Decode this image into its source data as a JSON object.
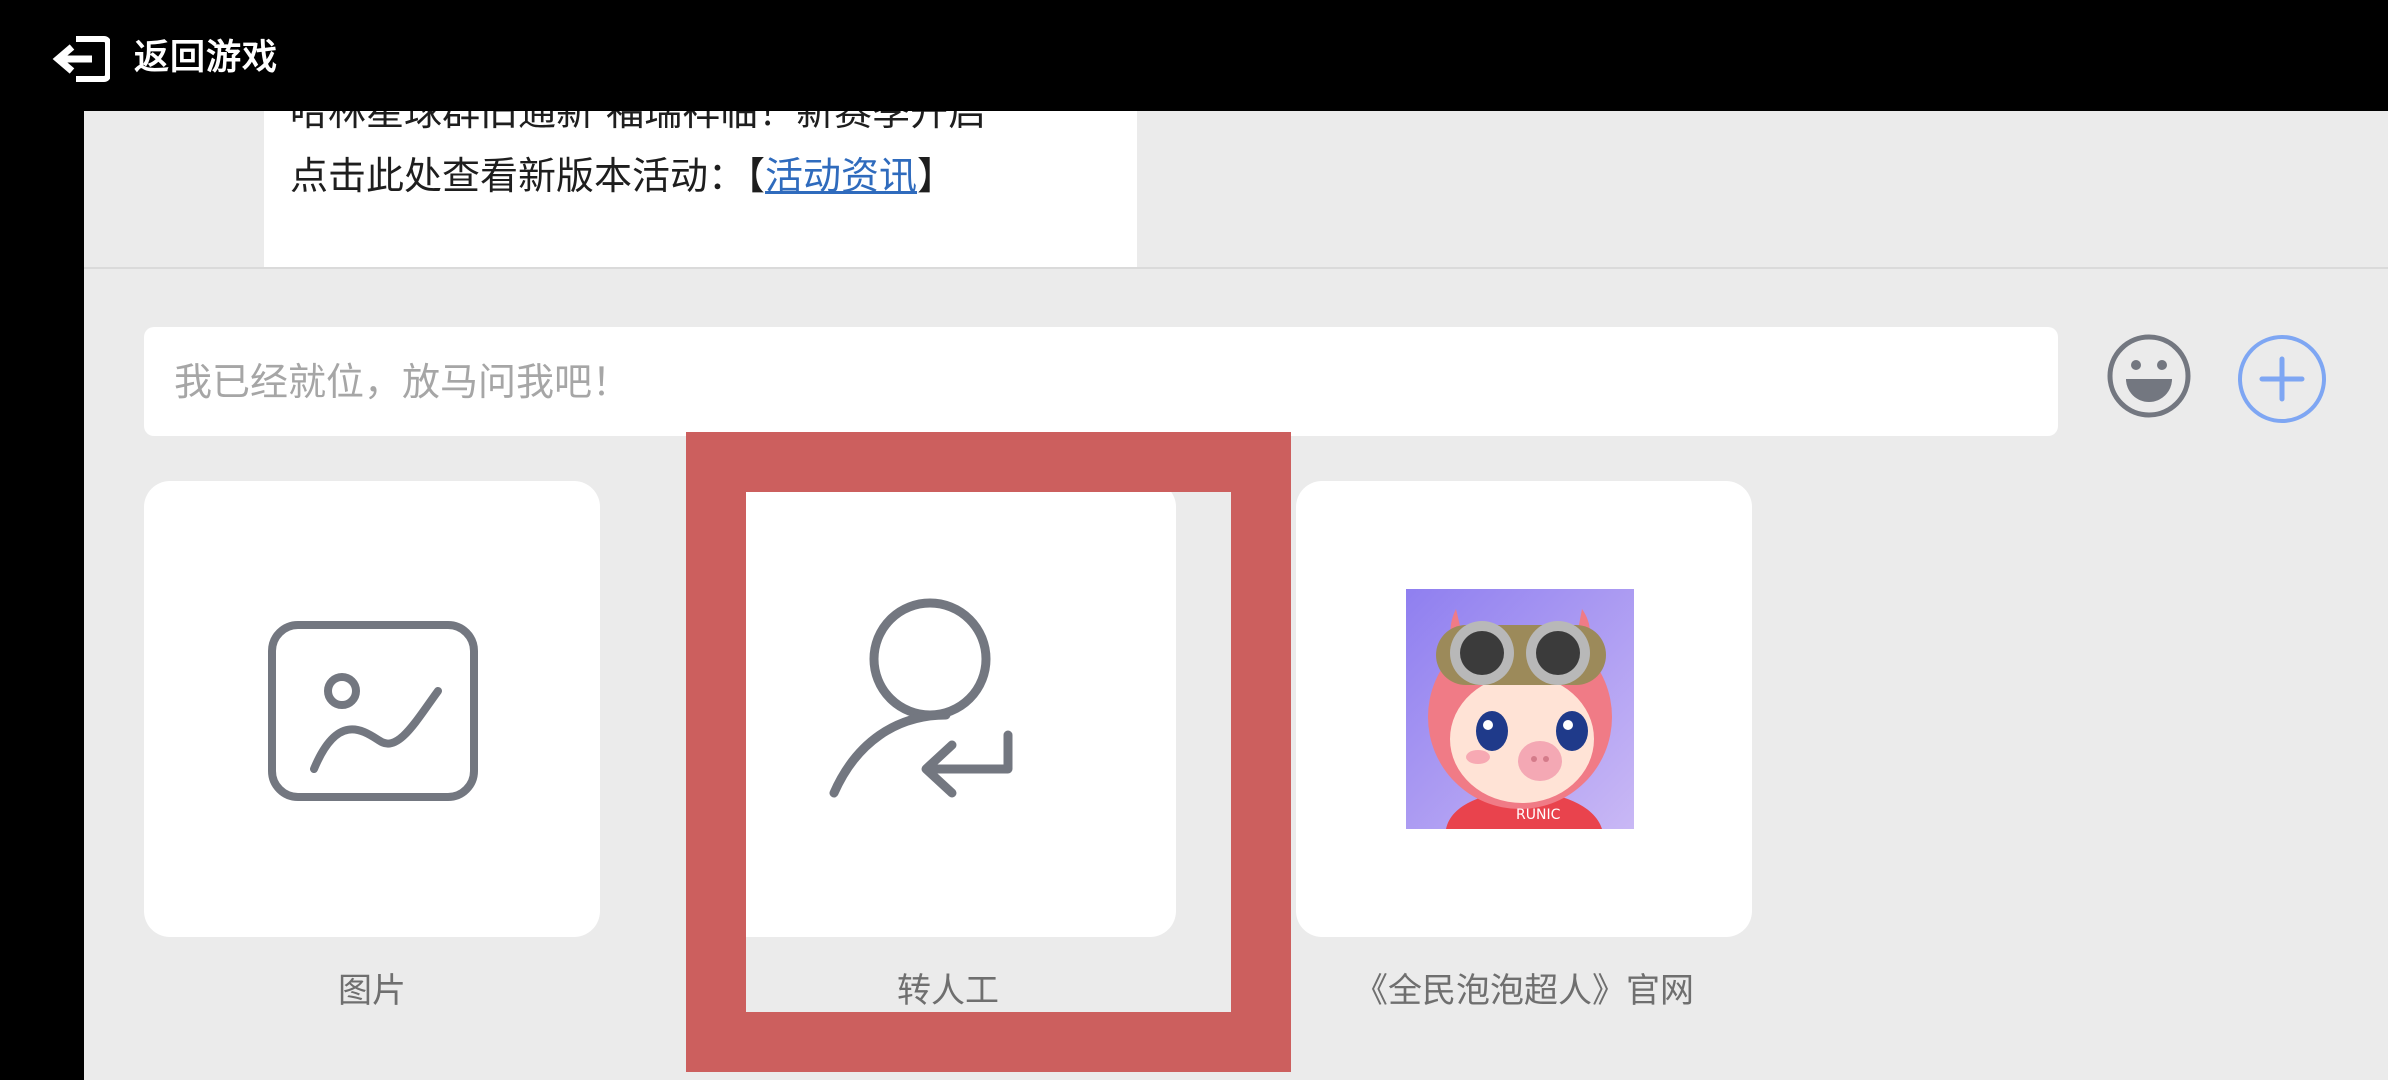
{
  "topbar": {
    "back_label": "返回游戏",
    "back_icon": "exit-arrow-icon"
  },
  "message": {
    "line1": "哈林星球群旧通新 福瑞祥临！新赛季开启",
    "line2_prefix": "点击此处查看新版本活动：【",
    "line2_link": "活动资讯",
    "line2_suffix": "】"
  },
  "input": {
    "placeholder": "我已经就位，放马问我吧！",
    "value": ""
  },
  "buttons": {
    "emoji_icon": "smiley-icon",
    "plus_icon": "plus-icon"
  },
  "tiles": [
    {
      "label": "图片",
      "icon": "picture-icon"
    },
    {
      "label": "转人工",
      "icon": "transfer-to-human-icon"
    },
    {
      "label": "《全民泡泡超人》官网",
      "icon": "game-avatar-image"
    }
  ],
  "colors": {
    "background": "#ebebeb",
    "topbar": "#000000",
    "link": "#2f6bbd",
    "accent_blue": "#7ea6f3",
    "highlight": "#cc5f5e",
    "icon_gray": "#737780"
  }
}
